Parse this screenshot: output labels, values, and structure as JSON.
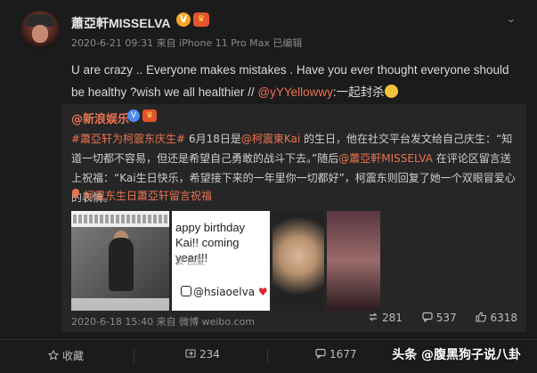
{
  "post": {
    "username": "蕭亞軒MISSELVA",
    "meta": "2020-6-21 09:31 来自 iPhone 11 Pro Max  已编辑",
    "text_main": "U are crazy .. Everyone makes mistakes . Have you ever thought everyone should be healthy ?wish we all healthier // ",
    "text_mention": "@yYYellowwy",
    "text_tail": ":一起封杀"
  },
  "repost": {
    "username": "@新浪娱乐",
    "text_tag1": "#蕭亞轩为柯震东庆生#",
    "text_p1": " 6月18日是",
    "text_mention1": "@柯震東Kai",
    "text_p2": " 的生日，他在社交平台发文给自己庆生：“知道一切都不容易，但还是希望自己勇敢的战斗下去。”随后",
    "text_mention2": "@蕭亞軒MISSELVA",
    "text_p3": " 在评论区留言送上祝福：“Kai生日快乐，希望接下来的一年里你一切都好”，柯震东则回复了她一个双眼冒爱心的表情。",
    "link": "柯震东生日蕭亞轩留言祝福",
    "photo2_msg": "appy birthday Kai!! coming year!!!",
    "photo2_reply": "赞    回复",
    "photo2_handle": "@hsiaoelva",
    "meta": "2020-6-18 15:40 来自 微博 weibo.com",
    "reposts": "281",
    "comments": "537",
    "likes": "6318"
  },
  "actions": {
    "favorite": "收藏",
    "repost": "234",
    "comment": "1677"
  },
  "watermark": "头条 @腹黑狗子说八卦",
  "icons": {
    "caret": "chevron-down-icon",
    "repost": "repost-icon",
    "comment": "comment-icon",
    "like": "like-icon",
    "favorite": "star-icon"
  },
  "colors": {
    "background": "#1b1b1b",
    "repost_bg": "#262626",
    "accent": "#eb7350",
    "verified": "#f5a623"
  }
}
